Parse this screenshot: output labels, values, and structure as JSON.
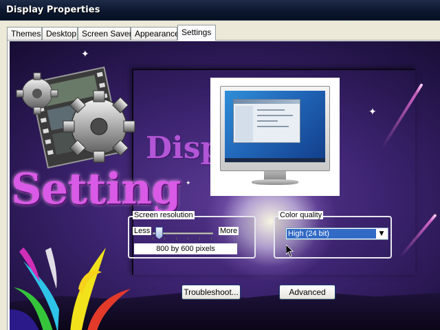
{
  "window": {
    "title": "Display Properties"
  },
  "tabs": [
    {
      "label": "Themes",
      "active": false
    },
    {
      "label": "Desktop",
      "active": false
    },
    {
      "label": "Screen Saver",
      "active": false
    },
    {
      "label": "Appearance",
      "active": false
    },
    {
      "label": "Settings",
      "active": true
    }
  ],
  "wallpaper": {
    "logo_text": "Setting",
    "secondary_text": "Displ"
  },
  "screen_resolution": {
    "group_label": "Screen resolution",
    "less_label": "Less",
    "more_label": "More",
    "value_text": "800 by 600 pixels",
    "slider_level_percent": 5
  },
  "color_quality": {
    "group_label": "Color quality",
    "selected": "High (24 bit)"
  },
  "buttons": {
    "troubleshoot": "Troubleshoot...",
    "advanced": "Advanced"
  },
  "colors": {
    "title_bar": "#0c1830",
    "selection_blue": "#316ac5",
    "wallpaper_purple": "#3d2471",
    "logo_magenta": "#d85ae6"
  }
}
